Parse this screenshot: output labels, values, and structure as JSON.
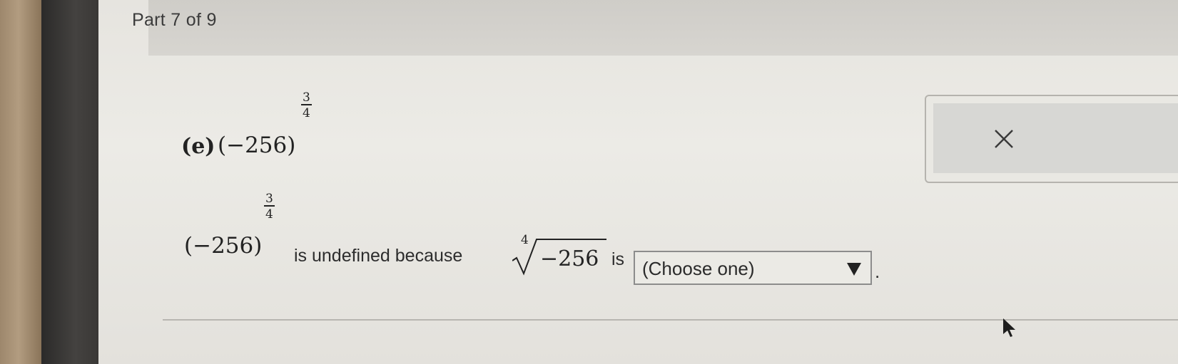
{
  "header": {
    "part_label": "Part 7 of 9"
  },
  "question": {
    "label": "(e)",
    "base": "(−256)",
    "exponent_numerator": "3",
    "exponent_denominator": "4"
  },
  "answer": {
    "base": "(−256)",
    "exponent_numerator": "3",
    "exponent_denominator": "4",
    "text_because": "is undefined because",
    "root_index": "4",
    "radicand": "−256",
    "text_is": "is",
    "dropdown_value": "(Choose one)",
    "period": "."
  },
  "icons": {
    "clear": "close-x-icon",
    "dropdown": "triangle-down-icon",
    "cursor": "mouse-pointer-icon"
  }
}
